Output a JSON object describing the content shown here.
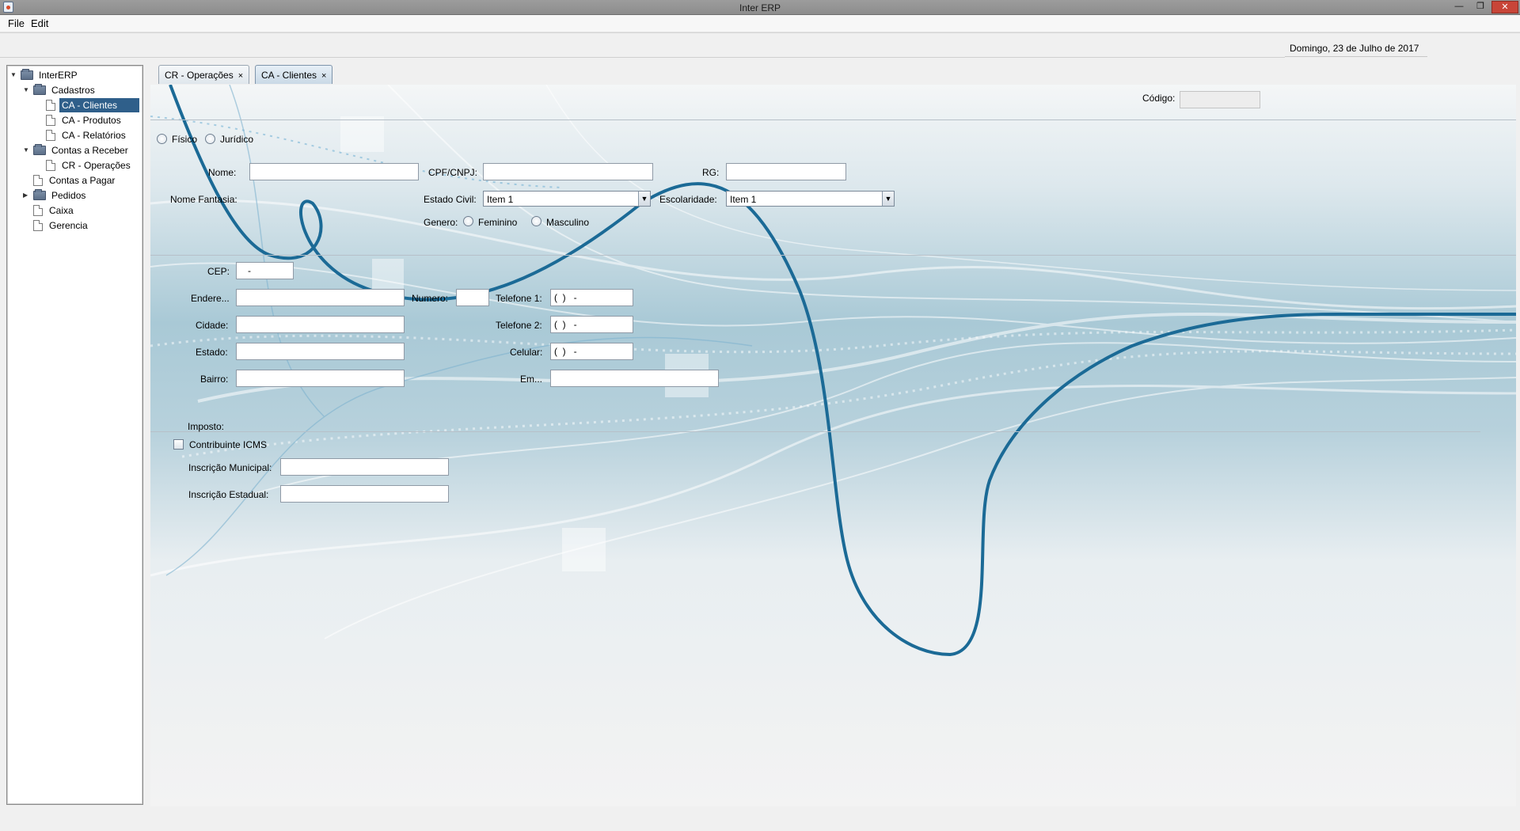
{
  "window": {
    "title": "Inter ERP",
    "minimize": "—",
    "restore": "❐",
    "close": "✕"
  },
  "menu": {
    "file": "File",
    "edit": "Edit"
  },
  "date": "Domingo, 23 de Julho de 2017",
  "tree": {
    "root": "InterERP",
    "cadastros": "Cadastros",
    "ca_clientes": "CA - Clientes",
    "ca_produtos": "CA - Produtos",
    "ca_relatorios": "CA - Relatórios",
    "contas_receber": "Contas a Receber",
    "cr_operacoes": "CR - Operações",
    "contas_pagar": "Contas a Pagar",
    "pedidos": "Pedidos",
    "caixa": "Caixa",
    "gerencia": "Gerencia"
  },
  "tabs": [
    {
      "label": "CR - Operações",
      "close": "×"
    },
    {
      "label": "CA - Clientes",
      "close": "×"
    }
  ],
  "form": {
    "codigo_label": "Código:",
    "codigo_value": "",
    "tipo_fisico": "Físico",
    "tipo_juridico": "Jurídico",
    "nome_label": "Nome:",
    "cpf_label": "CPF/CNPJ:",
    "rg_label": "RG:",
    "nome_fantasia_label": "Nome Fantasia:",
    "estado_civil_label": "Estado Civil:",
    "estado_civil_value": "Item 1",
    "escolaridade_label": "Escolaridade:",
    "escolaridade_value": "Item 1",
    "genero_label": "Genero:",
    "feminino": "Feminino",
    "masculino": "Masculino",
    "cep_label": "CEP:",
    "cep_value": "   -",
    "endereco_label": "Endere...",
    "numero_label": "Numero:",
    "telefone1_label": "Telefone 1:",
    "telefone1_value": "(  )   -",
    "cidade_label": "Cidade:",
    "telefone2_label": "Telefone 2:",
    "telefone2_value": "(  )   -",
    "estado_label": "Estado:",
    "celular_label": "Celular:",
    "celular_value": "(  )   -",
    "bairro_label": "Bairro:",
    "email_label": "Em...",
    "imposto_label": "Imposto:",
    "contribuinte_label": "Contribuinte ICMS",
    "insc_municipal_label": "Inscrição Municipal:",
    "insc_estadual_label": "Inscrição Estadual:"
  },
  "colors": {
    "accent": "#2f5f8a",
    "wave": "#1b6a96",
    "background_gradient": "#a9c9d6"
  }
}
